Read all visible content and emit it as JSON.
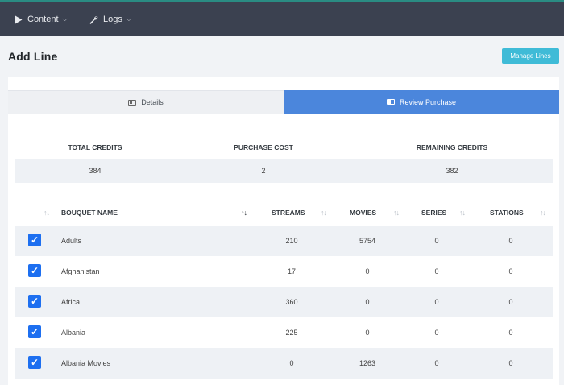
{
  "nav": {
    "items": [
      {
        "label": "Content",
        "icon": "play-icon"
      },
      {
        "label": "Logs",
        "icon": "wrench-icon"
      }
    ]
  },
  "page": {
    "title": "Add Line",
    "manage_button": "Manage Lines"
  },
  "tabs": [
    {
      "label": "Details",
      "active": false
    },
    {
      "label": "Review Purchase",
      "active": true
    }
  ],
  "credits": {
    "headers": [
      "TOTAL CREDITS",
      "PURCHASE COST",
      "REMAINING CREDITS"
    ],
    "values": [
      "384",
      "2",
      "382"
    ]
  },
  "table": {
    "columns": [
      "BOUQUET NAME",
      "STREAMS",
      "MOVIES",
      "SERIES",
      "STATIONS"
    ],
    "rows": [
      {
        "name": "Adults",
        "streams": "210",
        "movies": "5754",
        "series": "0",
        "stations": "0",
        "checked": true
      },
      {
        "name": "Afghanistan",
        "streams": "17",
        "movies": "0",
        "series": "0",
        "stations": "0",
        "checked": true
      },
      {
        "name": "Africa",
        "streams": "360",
        "movies": "0",
        "series": "0",
        "stations": "0",
        "checked": true
      },
      {
        "name": "Albania",
        "streams": "225",
        "movies": "0",
        "series": "0",
        "stations": "0",
        "checked": true
      },
      {
        "name": "Albania Movies",
        "streams": "0",
        "movies": "1263",
        "series": "0",
        "stations": "0",
        "checked": true
      }
    ]
  },
  "colors": {
    "topbar": "#3b4150",
    "accent_tab": "#4b86dc",
    "manage_button": "#3fbbd7",
    "checkbox": "#1d6ff0"
  }
}
